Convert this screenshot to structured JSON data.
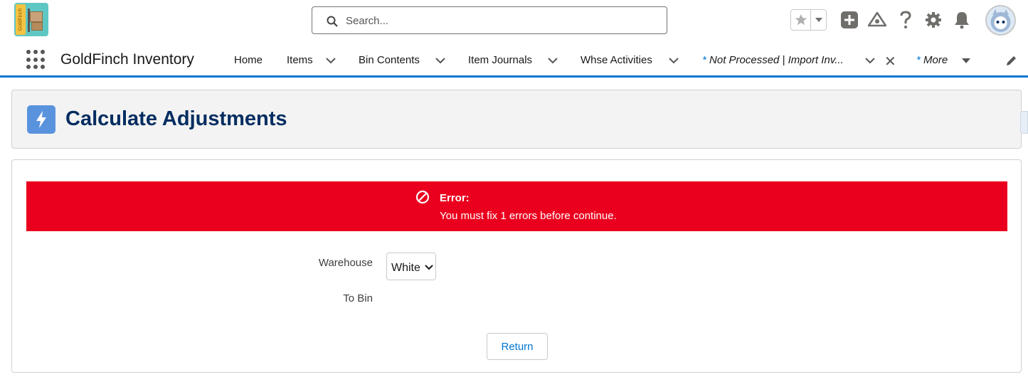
{
  "header": {
    "search_placeholder": "Search...",
    "logo_text": "GoldFinch"
  },
  "nav": {
    "app_name": "GoldFinch Inventory",
    "items": [
      {
        "label": "Home"
      },
      {
        "label": "Items"
      },
      {
        "label": "Bin Contents"
      },
      {
        "label": "Item Journals"
      },
      {
        "label": "Whse Activities"
      }
    ],
    "open_tab": {
      "marker": "*",
      "label": "Not Processed | Import Inv..."
    },
    "more": {
      "marker": "*",
      "label": "More"
    }
  },
  "page": {
    "title": "Calculate Adjustments"
  },
  "error": {
    "title": "Error:",
    "message": "You must fix 1 errors before continue."
  },
  "form": {
    "warehouse_label": "Warehouse",
    "warehouse_value": "White",
    "to_bin_label": "To Bin"
  },
  "actions": {
    "return_label": "Return"
  },
  "colors": {
    "brand": "#0176d3",
    "error": "#ea001e",
    "title": "#032d60"
  }
}
